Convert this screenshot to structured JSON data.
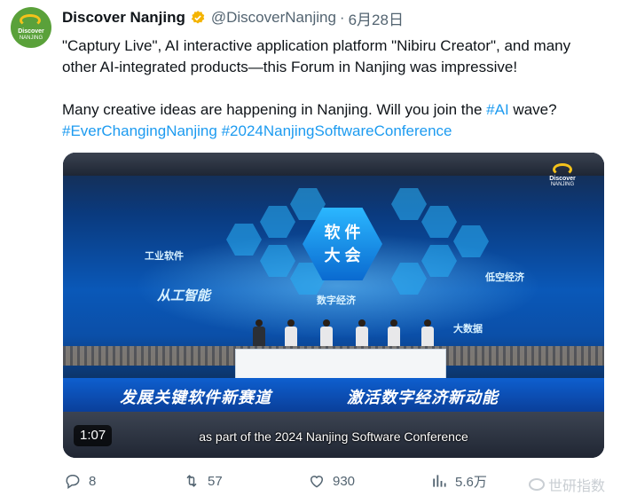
{
  "author": {
    "name": "Discover Nanjing",
    "handle": "@DiscoverNanjing",
    "separator": "·",
    "date": "6月28日",
    "avatar_text_top": "Discover",
    "avatar_text_bottom": "NANJING",
    "verified_badge_color": "#f4b400"
  },
  "tweet": {
    "paragraph1": "\"Captury Live\", AI interactive application platform \"Nibiru Creator\", and many other AI-integrated products—this Forum in Nanjing was impressive!",
    "paragraph2_before": "Many creative ideas are happening in Nanjing. Will you join the ",
    "paragraph2_hashtag": "#AI",
    "paragraph2_after": " wave?",
    "hashtags": [
      "#EverChangingNanjing",
      "#2024NanjingSoftwareConference"
    ],
    "hashtag_color": "#1d9bf0"
  },
  "video": {
    "duration": "1:07",
    "caption": "as part of the 2024 Nanjing Software Conference",
    "badge_top": "Discover",
    "badge_bottom": "NANJING",
    "stage": {
      "center_line1": "软 件",
      "center_line2": "大 会",
      "label_left_top": "工业软件",
      "label_left_bottom": "从工智能",
      "label_right_top": "低空经济",
      "label_right_bottom": "大数据",
      "label_center_bottom": "数字经济",
      "banner_left": "发展关键软件新赛道",
      "banner_right": "激活数字经济新动能"
    }
  },
  "actions": {
    "replies": "8",
    "reposts": "57",
    "likes": "930",
    "views": "5.6万"
  },
  "watermark": "世研指数"
}
